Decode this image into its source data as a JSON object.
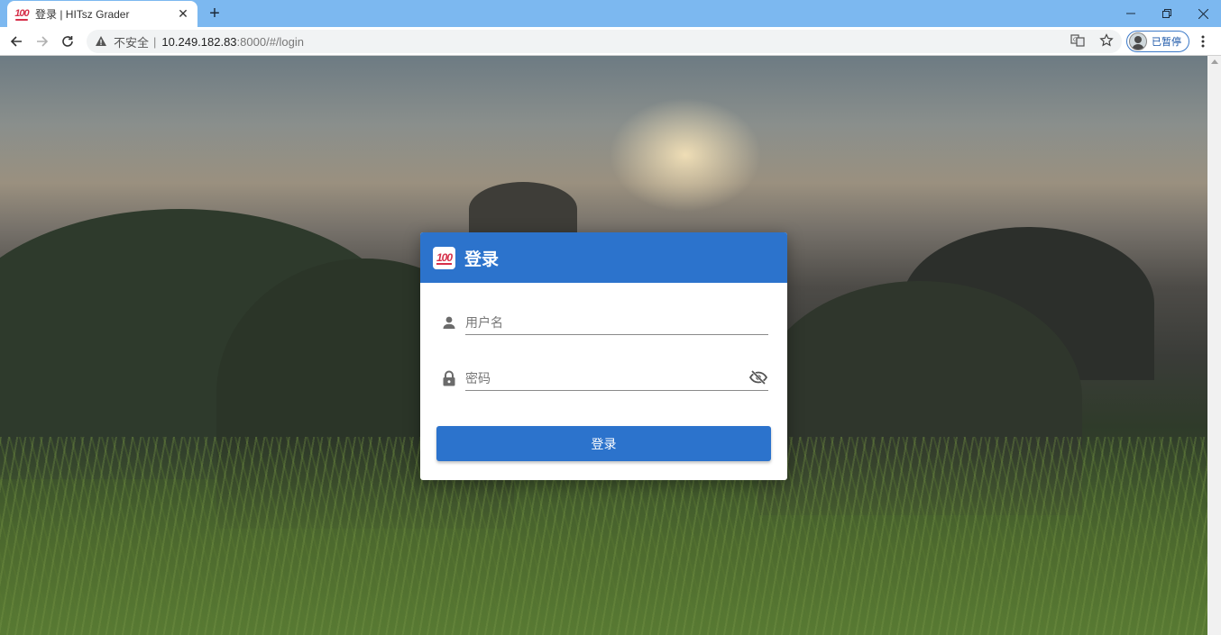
{
  "browser": {
    "tab": {
      "favicon": "hundred-points-emoji",
      "title": "登录 | HITsz Grader",
      "close_symbol": "✕"
    },
    "new_tab_symbol": "+",
    "address_bar": {
      "security_label": "不安全",
      "separator": "|",
      "url_host": "10.249.182.83",
      "url_rest": ":8000/#/login"
    },
    "profile": {
      "label": "已暂停"
    }
  },
  "login": {
    "title": "登录",
    "logo": "hundred-points-emoji",
    "username": {
      "placeholder": "用户名",
      "value": ""
    },
    "password": {
      "placeholder": "密码",
      "value": ""
    },
    "submit_label": "登录"
  },
  "colors": {
    "primary": "#2c73cc",
    "tab_strip": "#7cb8f0",
    "logo_red": "#d6304a"
  }
}
